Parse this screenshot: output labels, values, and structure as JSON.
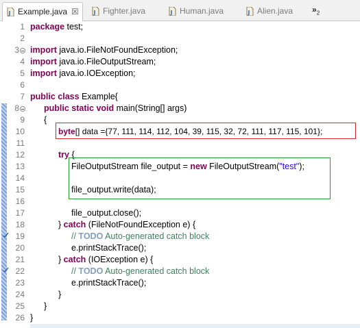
{
  "tabs": [
    {
      "label": "Example.java",
      "active": true,
      "close_glyph": "☒"
    },
    {
      "label": "Fighter.java",
      "active": false
    },
    {
      "label": "Human.java",
      "active": false
    },
    {
      "label": "Alien.java",
      "active": false
    }
  ],
  "overflow": {
    "glyph": "»",
    "count": "2"
  },
  "line_numbers": [
    "1",
    "2",
    "3",
    "4",
    "5",
    "6",
    "7",
    "8",
    "9",
    "10",
    "11",
    "12",
    "13",
    "14",
    "15",
    "16",
    "17",
    "18",
    "19",
    "20",
    "21",
    "22",
    "23",
    "24",
    "25",
    "26"
  ],
  "code": {
    "l1_kw": "package",
    "l1_rest": " test;",
    "l3_kw": "import",
    "l3_rest": " java.io.FileNotFoundException;",
    "l4_kw": "import",
    "l4_rest": " java.io.FileOutputStream;",
    "l5_kw": "import",
    "l5_rest": " java.io.IOException;",
    "l7_kw1": "public",
    "l7_kw2": "class",
    "l7_rest": " Example{",
    "l8_kw1": "public",
    "l8_kw2": "static",
    "l8_kw3": "void",
    "l8_rest": " main(String[] args)",
    "l9": "{",
    "l10_kw": "byte",
    "l10_rest": "[] data ={77, 111, 114, 112, 104, 39, 115, 32, 72, 111, 117, 115, 101};",
    "l12_kw": "try",
    "l12_rest": " {",
    "l13_a": "FileOutputStream file_output = ",
    "l13_kw": "new",
    "l13_b": " FileOutputStream(",
    "l13_str": "\"test\"",
    "l13_c": ");",
    "l15": "file_output.write(data);",
    "l17": "file_output.close();",
    "l18_a": "} ",
    "l18_kw": "catch",
    "l18_rest": " (FileNotFoundException e) {",
    "l19_cmt": "// ",
    "l19_todo": "TODO",
    "l19_rest": " Auto-generated catch block",
    "l20": "e.printStackTrace();",
    "l21_a": "} ",
    "l21_kw": "catch",
    "l21_rest": " (IOException e) {",
    "l22_cmt": "// ",
    "l22_todo": "TODO",
    "l22_rest": " Auto-generated catch block",
    "l23": "e.printStackTrace();",
    "l24": "}",
    "l25": "}",
    "l26": "}"
  },
  "colors": {
    "keyword": "#7f0055",
    "string": "#2a00ff",
    "comment": "#3f7f5f",
    "highlight_red": "#d9262a",
    "highlight_green": "#1e9b3a"
  },
  "icons": {
    "file_icon": "java-file-icon",
    "fold_icon": "fold-toggle-icon",
    "task_icon": "task-marker-icon"
  }
}
